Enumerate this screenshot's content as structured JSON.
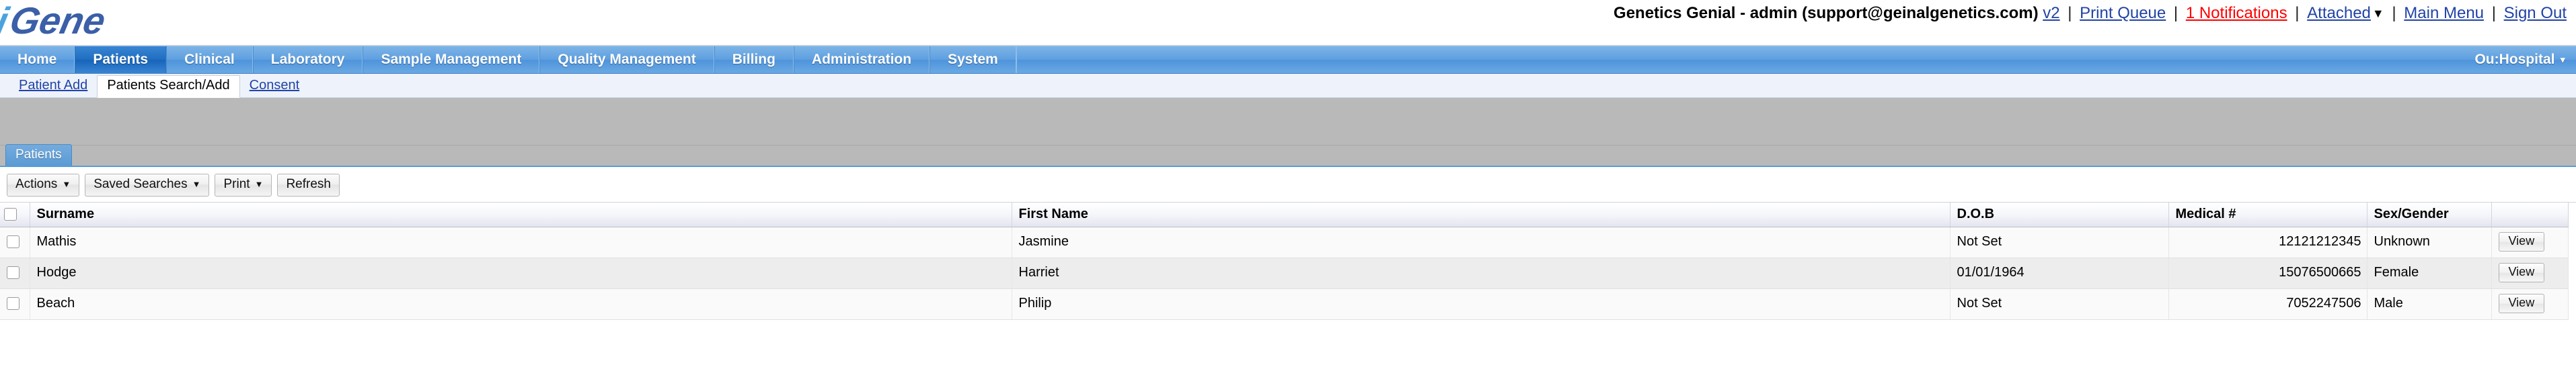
{
  "header": {
    "logo_text": "iGene",
    "account_label": "Genetics Genial - admin (support@geinalgenetics.com)",
    "version_link": "v2",
    "print_queue_link": "Print Queue",
    "notifications_link": "1 Notifications",
    "attached_link": "Attached",
    "attached_caret": "▼",
    "main_menu_link": "Main Menu",
    "sign_out_link": "Sign Out",
    "separator": "|",
    "notification_color": "#ff0000",
    "link_color": "#2143a6"
  },
  "main_nav": {
    "items": [
      {
        "label": "Home",
        "active": false
      },
      {
        "label": "Patients",
        "active": true
      },
      {
        "label": "Clinical",
        "active": false
      },
      {
        "label": "Laboratory",
        "active": false
      },
      {
        "label": "Sample Management",
        "active": false
      },
      {
        "label": "Quality Management",
        "active": false
      },
      {
        "label": "Billing",
        "active": false
      },
      {
        "label": "Administration",
        "active": false
      },
      {
        "label": "System",
        "active": false
      }
    ],
    "ou_label": "Ou:Hospital",
    "ou_caret": "▾",
    "accent_color": "#5e9fe0"
  },
  "sub_nav": {
    "items": [
      {
        "label": "Patient Add",
        "current": false
      },
      {
        "label": "Patients Search/Add",
        "current": true
      },
      {
        "label": "Consent",
        "current": false
      }
    ]
  },
  "panel": {
    "tab_label": "Patients"
  },
  "toolbar": {
    "actions_label": "Actions",
    "saved_searches_label": "Saved Searches",
    "print_label": "Print",
    "refresh_label": "Refresh",
    "caret": "▼"
  },
  "table": {
    "columns": [
      {
        "key": "check",
        "label": ""
      },
      {
        "key": "surname",
        "label": "Surname"
      },
      {
        "key": "first_name",
        "label": "First Name"
      },
      {
        "key": "dob",
        "label": "D.O.B"
      },
      {
        "key": "medical_no",
        "label": "Medical #"
      },
      {
        "key": "sex_gender",
        "label": "Sex/Gender"
      },
      {
        "key": "action",
        "label": ""
      }
    ],
    "rows": [
      {
        "surname": "Mathis",
        "first_name": "Jasmine",
        "dob": "Not Set",
        "medical_no": "12121212345",
        "sex_gender": "Unknown",
        "action_label": "View"
      },
      {
        "surname": "Hodge",
        "first_name": "Harriet",
        "dob": "01/01/1964",
        "medical_no": "15076500665",
        "sex_gender": "Female",
        "action_label": "View"
      },
      {
        "surname": "Beach",
        "first_name": "Philip",
        "dob": "Not Set",
        "medical_no": "7052247506",
        "sex_gender": "Male",
        "action_label": "View"
      }
    ]
  }
}
